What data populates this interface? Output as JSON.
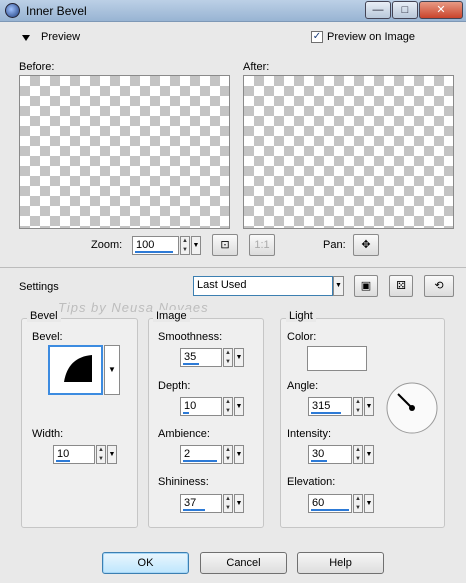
{
  "window": {
    "title": "Inner Bevel",
    "controls": {
      "minimize": "—",
      "maximize": "□",
      "close": "✕"
    }
  },
  "preview": {
    "section_label": "Preview",
    "preview_on_image_label": "Preview on Image",
    "preview_on_image_checked": "✓",
    "before_label": "Before:",
    "after_label": "After:",
    "zoom_label": "Zoom:",
    "zoom_value": "100",
    "fit_label": "1:1",
    "pan_label": "Pan:"
  },
  "settings": {
    "label": "Settings",
    "preset_value": "Last Used",
    "watermark": "Tips by Neusa Novaes"
  },
  "bevel": {
    "group_label": "Bevel",
    "bevel_label": "Bevel:",
    "width_label": "Width:",
    "width_value": "10"
  },
  "image": {
    "group_label": "Image",
    "smoothness_label": "Smoothness:",
    "smoothness_value": "35",
    "depth_label": "Depth:",
    "depth_value": "10",
    "ambience_label": "Ambience:",
    "ambience_value": "2",
    "shininess_label": "Shininess:",
    "shininess_value": "37"
  },
  "light": {
    "group_label": "Light",
    "color_label": "Color:",
    "color_value": "#ffffff",
    "angle_label": "Angle:",
    "angle_value": "315",
    "intensity_label": "Intensity:",
    "intensity_value": "30",
    "elevation_label": "Elevation:",
    "elevation_value": "60"
  },
  "buttons": {
    "ok": "OK",
    "cancel": "Cancel",
    "help": "Help"
  }
}
